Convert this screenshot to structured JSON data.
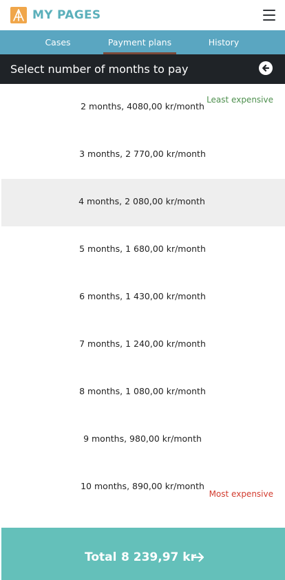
{
  "header": {
    "brand": "MY PAGES",
    "logo_icon": "logo-icon",
    "menu_icon": "hamburger-menu-icon"
  },
  "tabs": [
    {
      "label": "Cases"
    },
    {
      "label": "Payment plans",
      "active": true
    },
    {
      "label": "History"
    }
  ],
  "section": {
    "title": "Select number of months to pay",
    "back_icon": "back-arrow-icon"
  },
  "options": [
    {
      "label": "2 months, 4080,00 kr/month"
    },
    {
      "label": "3 months, 2 770,00 kr/month"
    },
    {
      "label": "4 months, 2 080,00 kr/month"
    },
    {
      "label": "5 months, 1 680,00 kr/month"
    },
    {
      "label": "6 months, 1 430,00 kr/month"
    },
    {
      "label": "7 months, 1 240,00 kr/month"
    },
    {
      "label": "8 months, 1 080,00 kr/month"
    },
    {
      "label": "9 months, 980,00 kr/month"
    },
    {
      "label": "10 months, 890,00 kr/month"
    }
  ],
  "selected_index": 2,
  "tags": {
    "least": "Least expensive",
    "most": "Most expensive"
  },
  "footer": {
    "total_label": "Total",
    "total_amount": "8 239,97 kr",
    "arrow_icon": "arrow-right-icon"
  },
  "colors": {
    "brand": "#5bb0bb",
    "tabs_bg": "#5aa6c1",
    "heading_bg": "#1f2327",
    "least_tag": "#4d8f4d",
    "most_tag": "#d23b2e",
    "total_bg": "#64c0ba",
    "selected_bg": "#eeeeee"
  }
}
